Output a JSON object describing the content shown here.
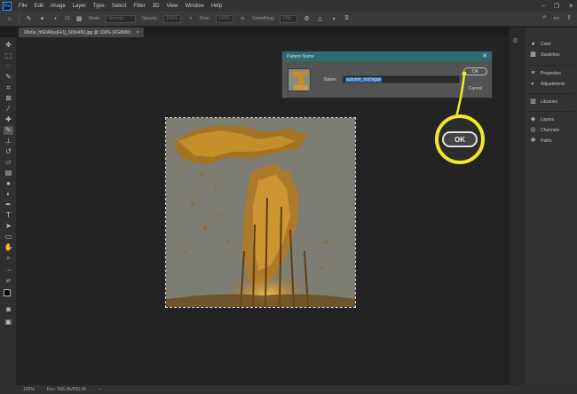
{
  "menubar": {
    "logo": "Ps",
    "items": [
      "File",
      "Edit",
      "Image",
      "Layer",
      "Type",
      "Select",
      "Filter",
      "3D",
      "View",
      "Window",
      "Help"
    ]
  },
  "options": {
    "brush_size": "13",
    "mode_label": "Mode:",
    "mode_value": "Normal",
    "opacity_label": "Opacity:",
    "opacity_value": "100%",
    "flow_label": "Flow:",
    "flow_value": "100%",
    "smoothing_label": "Smoothing:",
    "smoothing_value": "10%"
  },
  "document": {
    "tab_title": "00x0e_hN2ANyqFk1j_600x450.jpg @ 100% (RGB/8#)",
    "tab_close": "×"
  },
  "status": {
    "zoom": "100%",
    "doc_size": "Doc: 593.3K/593.3K"
  },
  "panels": {
    "items": [
      "Color",
      "Swatches",
      "Properties",
      "Adjustments",
      "Libraries",
      "Layers",
      "Channels",
      "Paths"
    ]
  },
  "dialog": {
    "title": "Pattern Name",
    "close": "✕",
    "name_label": "Name:",
    "name_value": "autumn_michigan",
    "ok_label": "OK",
    "cancel_label": "Cancel"
  },
  "callout": {
    "label": "OK",
    "color": "#f1e829"
  },
  "colors": {
    "accent_blue": "#2f62a8",
    "dialog_title": "#2a6c72"
  }
}
